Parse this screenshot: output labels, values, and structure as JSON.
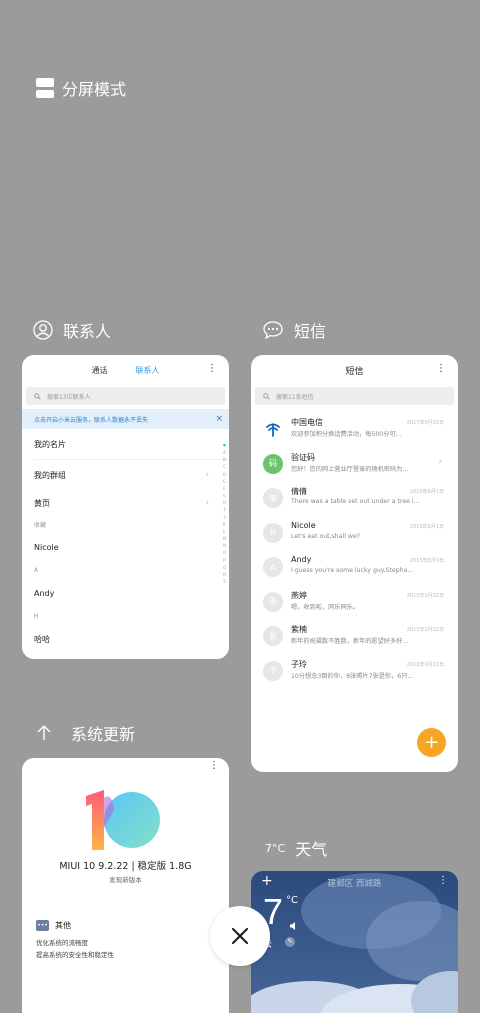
{
  "split_mode": {
    "label": "分屏模式",
    "icon": "split-screen-icon"
  },
  "contacts": {
    "app_name": "联系人",
    "icon": "person-icon",
    "tabs": [
      "通话",
      "联系人"
    ],
    "active_tab": "联系人",
    "more": "⋮",
    "search_placeholder": "搜索13位联系人",
    "banner_text": "点击开启小米云服务，联系人数据永不丢失",
    "banner_close": "×",
    "items": {
      "my_card": "我的名片",
      "my_groups": "我的群组",
      "yellow_pages": "黄页",
      "favorites_header": "收藏",
      "fav1": "Nicole",
      "section_a": "A",
      "a1": "Andy",
      "section_h": "H",
      "h1": "哈哈"
    },
    "alphabet": "♥ABCDEFGHIJKLMNOPQRS"
  },
  "sms": {
    "app_name": "短信",
    "icon": "chat-bubble-icon",
    "title": "短信",
    "more": "⋮",
    "search_placeholder": "搜索11条短信",
    "messages": [
      {
        "avatar": "",
        "name": "中国电信",
        "preview": "欢迎参加积分换话费活动，每500分可...",
        "date": "2017年9月30日"
      },
      {
        "avatar": "码",
        "name": "验证码",
        "preview": "您好！您的网上营业厅登录的随机密码为...",
        "date": ""
      },
      {
        "avatar": "倩",
        "name": "倩倩",
        "preview": "There was a table set out under a tree i...",
        "date": "2015年6月1日"
      },
      {
        "avatar": "N",
        "name": "Nicole",
        "preview": "Let's eat out,shall we?",
        "date": "2015年6月1日"
      },
      {
        "avatar": "A",
        "name": "Andy",
        "preview": "I guess you're some lucky guy.Stepha...",
        "date": "2015年6月1日"
      },
      {
        "avatar": "燕",
        "name": "燕婷",
        "preview": "嗯，收到啦，同乐同乐。",
        "date": "2013年2月22日"
      },
      {
        "avatar": "紫",
        "name": "紫楠",
        "preview": "新年的祝福数不胜数，新年的愿望好多好...",
        "date": "2013年2月22日"
      },
      {
        "avatar": "子",
        "name": "子玲",
        "preview": "10分想念3倒的你，8张照片7张是你，6只...",
        "date": "2013年2月22日"
      }
    ],
    "fab": "+"
  },
  "update": {
    "app_name": "系统更新",
    "icon": "upload-arrow-icon",
    "more": "⋮",
    "version": "MIUI 10 9.2.22 | 稳定版 1.8G",
    "subtitle": "发现新版本",
    "other_label": "其他",
    "other_icon_text": "•••",
    "desc_line1": "优化系统的流畅度",
    "desc_line2": "提高系统的安全性和稳定性"
  },
  "weather": {
    "app_icon_text": "7°C",
    "app_name": "天气",
    "add": "+",
    "location": "建邺区 西城路",
    "more": "⋮",
    "temp": "7",
    "unit": "°C",
    "condition": "云"
  },
  "close": "×",
  "colors": {
    "accent_blue": "#2c97e8",
    "fab_orange": "#f6a623",
    "backdrop": "#9b9b9b"
  }
}
